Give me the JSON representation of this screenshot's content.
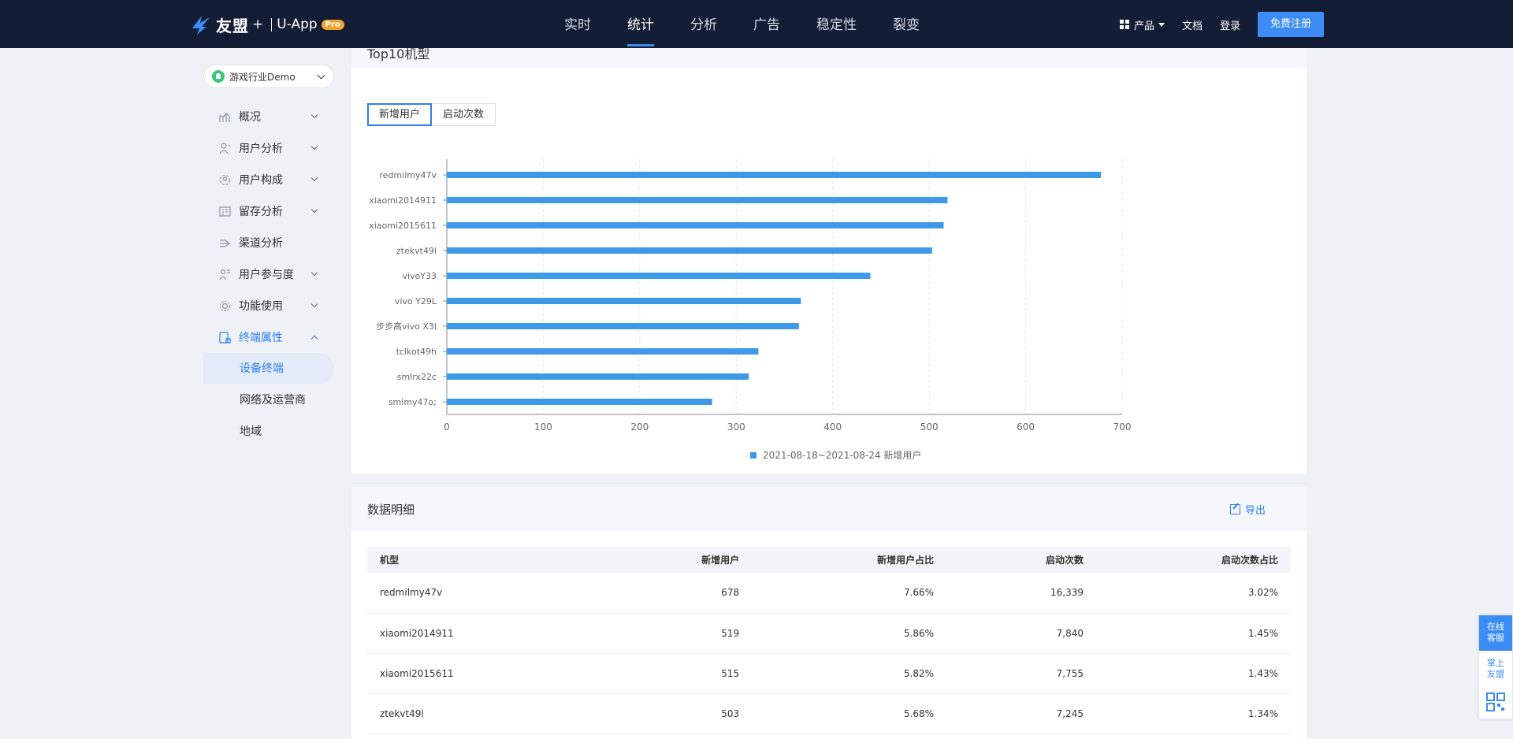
{
  "header": {
    "brand": "友盟",
    "plus": "+",
    "app": "U-App",
    "badge": "Pro",
    "nav": [
      "实时",
      "统计",
      "分析",
      "广告",
      "稳定性",
      "裂变"
    ],
    "active_nav": "统计",
    "product": "产品",
    "docs": "文档",
    "login": "登录",
    "signup": "免费注册"
  },
  "sidebar": {
    "app_name": "游戏行业Demo",
    "items": [
      {
        "label": "概况",
        "icon": "trend-icon"
      },
      {
        "label": "用户分析",
        "icon": "user-analysis-icon"
      },
      {
        "label": "用户构成",
        "icon": "user-composition-icon"
      },
      {
        "label": "留存分析",
        "icon": "retention-icon"
      },
      {
        "label": "渠道分析",
        "icon": "channel-icon"
      },
      {
        "label": "用户参与度",
        "icon": "engagement-icon"
      },
      {
        "label": "功能使用",
        "icon": "function-icon"
      },
      {
        "label": "终端属性",
        "icon": "terminal-icon"
      }
    ],
    "sub_items": [
      "设备终端",
      "网络及运营商",
      "地域"
    ],
    "active_sub": "设备终端"
  },
  "chart_card": {
    "title": "Top10机型",
    "tabs": [
      "新增用户",
      "启动次数"
    ],
    "active_tab": "新增用户"
  },
  "chart_data": {
    "type": "bar",
    "orientation": "horizontal",
    "categories": [
      "redmilmy47v",
      "xiaomi2014911",
      "xiaomi2015611",
      "ztekvt49l",
      "vivoY33",
      "vivo Y29L",
      "步步高vivo X3l",
      "tclkot49h",
      "smlrx22c",
      "smlmy47o;"
    ],
    "series": [
      {
        "name": "2021-08-18~2021-08-24 新增用户",
        "values": [
          678,
          519,
          515,
          503,
          439,
          367,
          365,
          323,
          313,
          275
        ]
      }
    ],
    "xticks": [
      0,
      100,
      200,
      300,
      400,
      500,
      600,
      700
    ],
    "xlim": [
      0,
      700
    ],
    "grid": true,
    "legend_position": "bottom-center",
    "color": "#3e9ae9"
  },
  "detail": {
    "title": "数据明细",
    "export": "导出",
    "columns": [
      "机型",
      "新增用户",
      "新增用户占比",
      "启动次数",
      "启动次数占比"
    ],
    "rows": [
      [
        "redmilmy47v",
        "678",
        "7.66%",
        "16,339",
        "3.02%"
      ],
      [
        "xiaomi2014911",
        "519",
        "5.86%",
        "7,840",
        "1.45%"
      ],
      [
        "xiaomi2015611",
        "515",
        "5.82%",
        "7,755",
        "1.43%"
      ],
      [
        "ztekvt49l",
        "503",
        "5.68%",
        "7,245",
        "1.34%"
      ]
    ]
  },
  "float": {
    "online": [
      "在线",
      "客服"
    ],
    "palm": [
      "掌上",
      "友盟"
    ]
  }
}
